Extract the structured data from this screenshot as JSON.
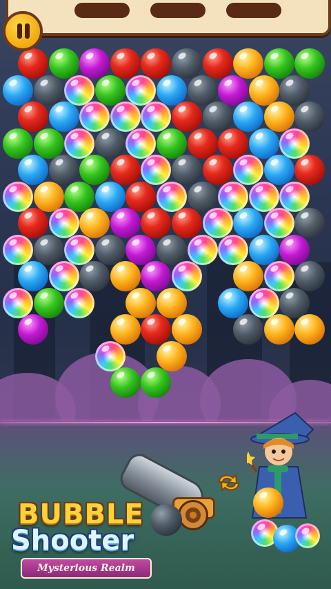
{
  "logo": {
    "line1": "BUBBLE",
    "line2": "Shooter",
    "tagline": "Mysterious Realm"
  },
  "icons": {
    "pause": "pause-icon",
    "swap": "swap-arrows-icon"
  },
  "colors": {
    "red": "#e52a1c",
    "green": "#34c41e",
    "blue": "#2aa8f4",
    "orange": "#ffb21c",
    "purple": "#c31ad2",
    "dark": "#4f5b66",
    "rainbow": "multicolor",
    "panel": "#f3e2bd",
    "panel_border": "#6b3a1e",
    "aim_line": "#ff9adf"
  },
  "board": {
    "rows": [
      {
        "offset": true,
        "cells": [
          "R",
          "G",
          "P",
          "R",
          "R",
          "D",
          "R",
          "O",
          "G",
          "G"
        ]
      },
      {
        "offset": false,
        "cells": [
          "B",
          "D",
          "W",
          "G",
          "W",
          "B",
          "D",
          "P",
          "O",
          "D",
          "X"
        ]
      },
      {
        "offset": true,
        "cells": [
          "R",
          "B",
          "W",
          "W",
          "W",
          "R",
          "D",
          "B",
          "O",
          "D"
        ]
      },
      {
        "offset": false,
        "cells": [
          "G",
          "G",
          "W",
          "D",
          "W",
          "G",
          "R",
          "R",
          "B",
          "W",
          "X"
        ]
      },
      {
        "offset": true,
        "cells": [
          "B",
          "D",
          "G",
          "R",
          "W",
          "D",
          "R",
          "W",
          "B",
          "R"
        ]
      },
      {
        "offset": false,
        "cells": [
          "W",
          "O",
          "G",
          "B",
          "R",
          "W",
          "D",
          "W",
          "W",
          "W",
          "X"
        ]
      },
      {
        "offset": true,
        "cells": [
          "R",
          "W",
          "O",
          "P",
          "R",
          "R",
          "W",
          "B",
          "W",
          "D"
        ]
      },
      {
        "offset": false,
        "cells": [
          "W",
          "D",
          "W",
          "D",
          "P",
          "D",
          "W",
          "W",
          "B",
          "P",
          "X"
        ]
      },
      {
        "offset": true,
        "cells": [
          "B",
          "W",
          "D",
          "O",
          "P",
          "W",
          "X",
          "O",
          "W",
          "D"
        ]
      },
      {
        "offset": false,
        "cells": [
          "W",
          "G",
          "W",
          "X",
          "O",
          "O",
          "X",
          "B",
          "W",
          "D",
          "X"
        ]
      },
      {
        "offset": true,
        "cells": [
          "P",
          "X",
          "X",
          "O",
          "R",
          "O",
          "X",
          "D",
          "O",
          "O"
        ]
      },
      {
        "offset": false,
        "cells": [
          "X",
          "X",
          "X",
          "W",
          "X",
          "O",
          "X",
          "X",
          "X",
          "X",
          "X"
        ]
      },
      {
        "offset": true,
        "cells": [
          "X",
          "X",
          "X",
          "G",
          "G",
          "X",
          "X",
          "X",
          "X",
          "X"
        ]
      }
    ]
  },
  "player": {
    "loaded_bubble": "dark",
    "next_bubbles": [
      "orange",
      "rainbow",
      "blue",
      "rainbow"
    ]
  }
}
